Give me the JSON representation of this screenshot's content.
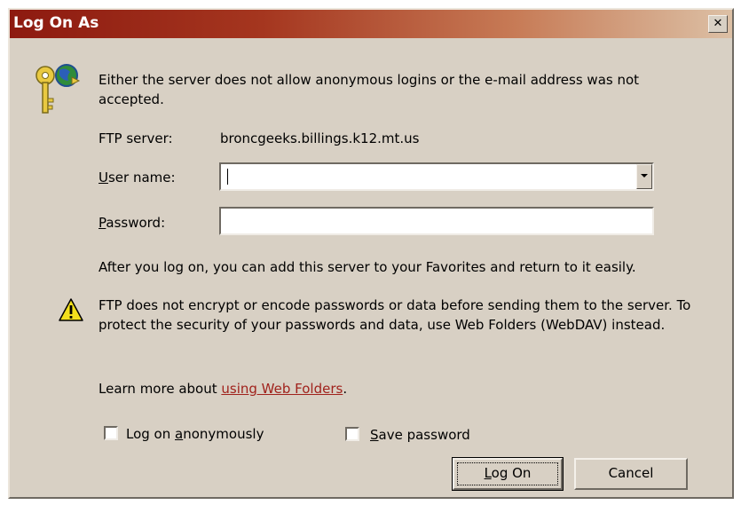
{
  "window": {
    "title": "Log On As",
    "close_glyph": "✕"
  },
  "message": "Either the server does not allow anonymous logins or the e-mail address was not accepted.",
  "ftp_server": {
    "label": "FTP server:",
    "value": "broncgeeks.billings.k12.mt.us"
  },
  "user_name": {
    "label_prefix": "U",
    "label_rest": "ser name:",
    "value": ""
  },
  "password": {
    "label_prefix": "P",
    "label_rest": "assword:",
    "value": ""
  },
  "favorites_note": "After you log on, you can add this server to your Favorites and return to it easily.",
  "warning": {
    "text": "FTP does not encrypt or encode passwords or data before sending them to the server.  To protect the security of your passwords and data, use Web Folders (WebDAV) instead."
  },
  "learn_more": {
    "prefix": "Learn more about ",
    "link": "using Web Folders",
    "suffix": "."
  },
  "anon_checkbox": {
    "label_before": "Log on ",
    "label_ul": "a",
    "label_after": "nonymously",
    "checked": false
  },
  "save_checkbox": {
    "label_ul": "S",
    "label_after": "ave password",
    "checked": false
  },
  "buttons": {
    "logon_ul": "L",
    "logon_rest": "og On",
    "cancel": "Cancel"
  },
  "colors": {
    "dialog_bg": "#d8d0c4",
    "title_start": "#8d1a10",
    "title_end": "#dcc0a5",
    "link": "#a0221c"
  },
  "icons": {
    "header": "keys-globe-icon",
    "warning": "warning-icon"
  }
}
